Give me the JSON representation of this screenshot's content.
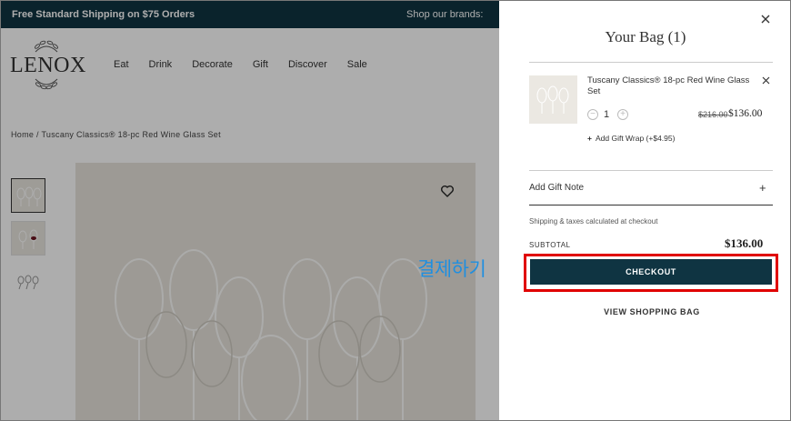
{
  "promo": {
    "left_text": "Free Standard Shipping on $75 Orders",
    "right_text": "Shop our brands:"
  },
  "logo": {
    "text": "LENOX"
  },
  "nav": {
    "items": [
      "Eat",
      "Drink",
      "Decorate",
      "Gift",
      "Discover",
      "Sale"
    ]
  },
  "breadcrumb": "Home / Tuscany Classics® 18-pc Red Wine Glass Set",
  "icons": {
    "wishlist": "heart-icon",
    "close": "close-icon",
    "remove": "close-icon",
    "minus": "minus-circle-icon",
    "plus": "plus-circle-icon"
  },
  "drawer": {
    "title": "Your Bag (1)",
    "item": {
      "name": "Tuscany Classics® 18-pc Red Wine Glass Set",
      "quantity": "1",
      "original_price": "$216.00",
      "sale_price": "$136.00",
      "gift_wrap_label": "Add Gift Wrap (+$4.95)"
    },
    "gift_note_label": "Add Gift Note",
    "gift_note_toggle": "+",
    "shipping_note": "Shipping & taxes calculated at checkout",
    "subtotal_label": "SUBTOTAL",
    "subtotal_value": "$136.00",
    "checkout_label": "CHECKOUT",
    "view_bag_label": "VIEW SHOPPING BAG"
  },
  "annotation": {
    "callout_text": "결제하기",
    "highlight_color": "#e00000"
  },
  "colors": {
    "brand_dark": "#0f3442",
    "callout": "#1f8fe0"
  }
}
